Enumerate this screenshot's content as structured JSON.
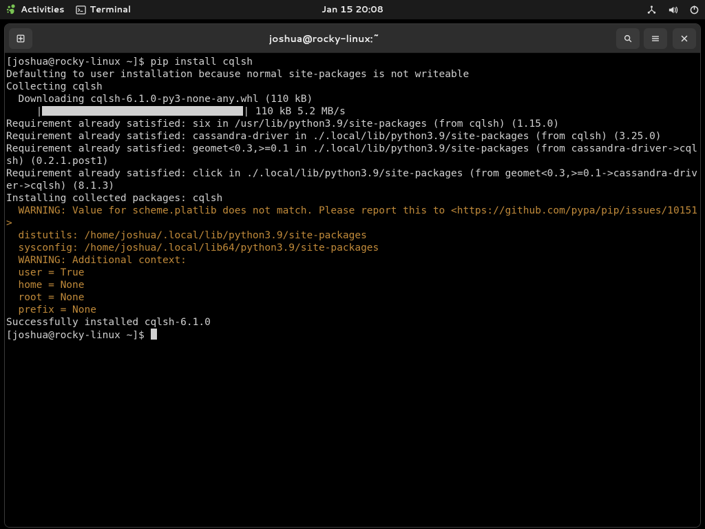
{
  "topbar": {
    "activities": "Activities",
    "app_label": "Terminal",
    "clock": "Jan 15  20:08"
  },
  "window": {
    "title": "joshua@rocky-linux:~"
  },
  "term": {
    "prompt1": "[joshua@rocky-linux ~]$ ",
    "cmd1": "pip install cqlsh",
    "l2": "Defaulting to user installation because normal site-packages is not writeable",
    "l3": "Collecting cqlsh",
    "l4": "  Downloading cqlsh-6.1.0-py3-none-any.whl (110 kB)",
    "progress_prefix": "     |",
    "progress_suffix": "| 110 kB 5.2 MB/s",
    "l6": "Requirement already satisfied: six in /usr/lib/python3.9/site-packages (from cqlsh) (1.15.0)",
    "l7": "Requirement already satisfied: cassandra-driver in ./.local/lib/python3.9/site-packages (from cqlsh) (3.25.0)",
    "l8": "Requirement already satisfied: geomet<0.3,>=0.1 in ./.local/lib/python3.9/site-packages (from cassandra-driver->cqlsh) (0.2.1.post1)",
    "l9": "Requirement already satisfied: click in ./.local/lib/python3.9/site-packages (from geomet<0.3,>=0.1->cassandra-driver->cqlsh) (8.1.3)",
    "l10": "Installing collected packages: cqlsh",
    "w1": "  WARNING: Value for scheme.platlib does not match. Please report this to <https://github.com/pypa/pip/issues/10151>",
    "w2": "  distutils: /home/joshua/.local/lib/python3.9/site-packages",
    "w3": "  sysconfig: /home/joshua/.local/lib64/python3.9/site-packages",
    "w4": "  WARNING: Additional context:",
    "w5": "  user = True",
    "w6": "  home = None",
    "w7": "  root = None",
    "w8": "  prefix = None",
    "l11": "Successfully installed cqlsh-6.1.0",
    "prompt2": "[joshua@rocky-linux ~]$ "
  }
}
